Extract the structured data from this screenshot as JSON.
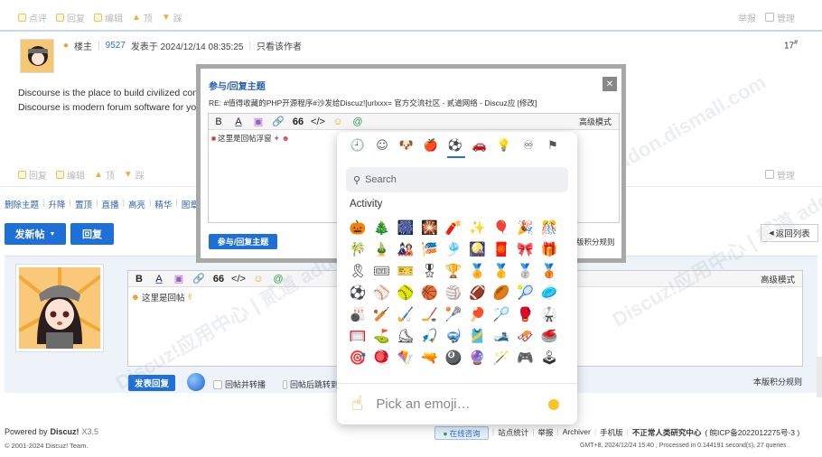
{
  "top_actions": {
    "comment": "点评",
    "reply": "回复",
    "edit": "编辑",
    "up": "顶",
    "down": "踩",
    "report": "举报",
    "manage": "管理"
  },
  "post": {
    "author_role": "楼主",
    "uid": "9527",
    "posted_at": "发表于 2024/12/14 08:35:25",
    "only_author": "只看该作者",
    "floor": "17",
    "floor_sup": "#",
    "line1": "Discourse is the place to build civilized comm",
    "line2": "Discourse is modern forum software for you"
  },
  "mod_links": [
    "删除主题",
    "升降",
    "置顶",
    "直播",
    "高亮",
    "精华",
    "图章"
  ],
  "buttons": {
    "new_thread": "发新帖",
    "reply": "回复",
    "back_list": "返回列表"
  },
  "dialog": {
    "title": "参与/回复主题",
    "subtitle": "RE: #值得收藏的PHP开源程序#沙发给Discuz![urlxxx= 官方交流社区 - 贰道网络 - Discuz应 [修改]",
    "advanced": "高级模式",
    "content": "这里是回帖浮窗",
    "submit": "参与/回复主题",
    "credit_rules": "版积分规则"
  },
  "toolbar": {
    "bold": "B",
    "color": "A",
    "link": "🔗",
    "quote": "66",
    "code": "</>"
  },
  "editor": {
    "advanced": "高级模式",
    "content": "这里是回帖",
    "submit": "发表回复",
    "opt1": "回帖并转播",
    "opt2": "回帖后跳转到",
    "credit_rules": "本版积分规则"
  },
  "emoji_picker": {
    "category_icons": [
      "🕘",
      "☺",
      "🐶",
      "🍎",
      "⚽",
      "🚗",
      "💡",
      "♾",
      "⚑"
    ],
    "active_category": 4,
    "search_placeholder": "Search",
    "section_title": "Activity",
    "emojis": [
      "🎃",
      "🎄",
      "🎆",
      "🎇",
      "🧨",
      "✨",
      "🎈",
      "🎉",
      "🎊",
      "🎋",
      "🎍",
      "🎎",
      "🎏",
      "🎐",
      "🎑",
      "🧧",
      "🎀",
      "🎁",
      "🎗",
      "🎟",
      "🎫",
      "🎖",
      "🏆",
      "🏅",
      "🥇",
      "🥈",
      "🥉",
      "⚽",
      "⚾",
      "🥎",
      "🏀",
      "🏐",
      "🏈",
      "🏉",
      "🎾",
      "🥏",
      "🎳",
      "🏏",
      "🏑",
      "🏒",
      "🥍",
      "🏓",
      "🏸",
      "🥊",
      "🥋",
      "🥅",
      "⛳",
      "⛸",
      "🎣",
      "🤿",
      "🎽",
      "🎿",
      "🛷",
      "🥌",
      "🎯",
      "🪀",
      "🪁",
      "🔫",
      "🎱",
      "🔮",
      "🪄",
      "🎮",
      "🕹"
    ],
    "preview_emoji": "☝",
    "preview_text": "Pick an emoji…"
  },
  "footer": {
    "powered_by": "Powered by",
    "brand": "Discuz!",
    "version": "X3.5",
    "copyright": "© 2001-2024 Discuz! Team.",
    "online": "在线咨询",
    "links": [
      "站点统计",
      "举报",
      "Archiver",
      "手机版",
      "不正常人类研究中心",
      "( 皖ICP备2022012275号-3 )"
    ],
    "stats": "GMT+8, 2024/12/24 15:40 , Processed in 0.144191 second(s), 27 queries ."
  },
  "watermark_text": "Discuz!应用中心 | 贰道 addon.dismall.com"
}
